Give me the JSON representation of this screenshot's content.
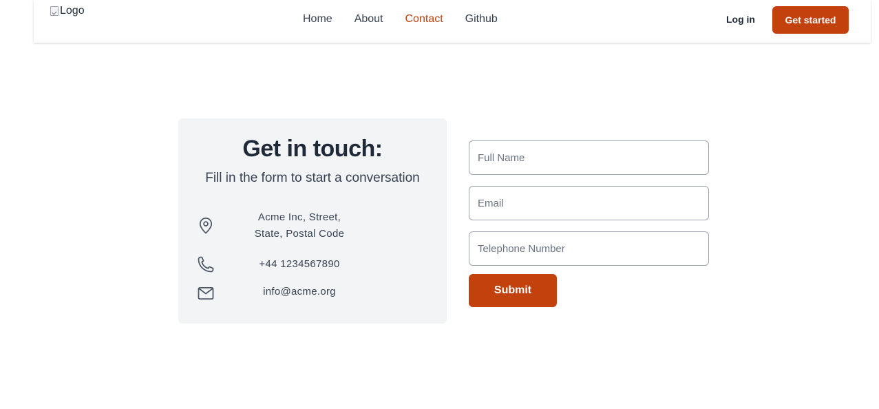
{
  "header": {
    "logo_alt": "Logo",
    "nav": [
      {
        "label": "Home",
        "active": false
      },
      {
        "label": "About",
        "active": false
      },
      {
        "label": "Contact",
        "active": true
      },
      {
        "label": "Github",
        "active": false
      }
    ],
    "login_label": "Log in",
    "cta_label": "Get started"
  },
  "contact": {
    "title": "Get in touch:",
    "subtitle": "Fill in the form to start a conversation",
    "address_line1": "Acme Inc, Street,",
    "address_line2": "State, Postal Code",
    "phone": "+44 1234567890",
    "email": "info@acme.org",
    "icons": [
      "location-pin-icon",
      "phone-icon",
      "mail-icon"
    ]
  },
  "form": {
    "name_placeholder": "Full Name",
    "email_placeholder": "Email",
    "tel_placeholder": "Telephone Number",
    "submit_label": "Submit"
  },
  "colors": {
    "accent": "#c2410c",
    "card_bg": "#f3f4f6",
    "text": "#1f2937"
  }
}
